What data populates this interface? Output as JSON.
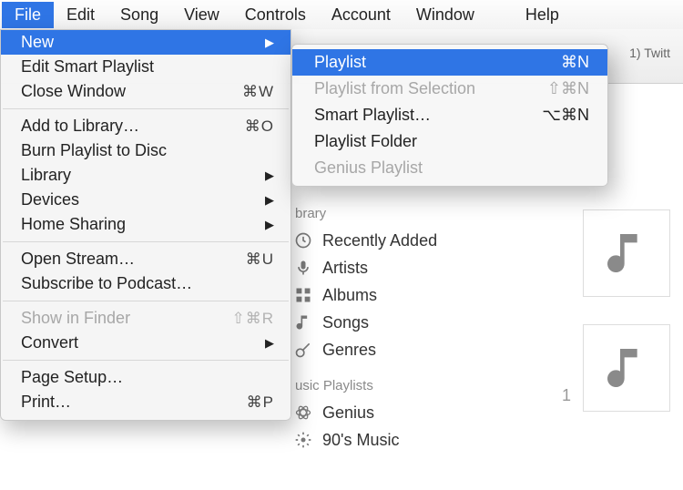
{
  "menubar": {
    "items": [
      "File",
      "Edit",
      "Song",
      "View",
      "Controls",
      "Account",
      "Window"
    ],
    "help": "Help",
    "active_index": 0
  },
  "tab_hint": "1) Twitt",
  "file_menu": {
    "rows": [
      {
        "label": "New",
        "type": "sub",
        "selected": true
      },
      {
        "label": "Edit Smart Playlist",
        "type": "item"
      },
      {
        "label": "Close Window",
        "type": "item",
        "shortcut": "⌘W"
      },
      {
        "type": "sep"
      },
      {
        "label": "Add to Library…",
        "type": "item",
        "shortcut": "⌘O"
      },
      {
        "label": "Burn Playlist to Disc",
        "type": "item"
      },
      {
        "label": "Library",
        "type": "sub"
      },
      {
        "label": "Devices",
        "type": "sub"
      },
      {
        "label": "Home Sharing",
        "type": "sub"
      },
      {
        "type": "sep"
      },
      {
        "label": "Open Stream…",
        "type": "item",
        "shortcut": "⌘U"
      },
      {
        "label": "Subscribe to Podcast…",
        "type": "item"
      },
      {
        "type": "sep"
      },
      {
        "label": "Show in Finder",
        "type": "item",
        "shortcut": "⇧⌘R",
        "disabled": true
      },
      {
        "label": "Convert",
        "type": "sub"
      },
      {
        "type": "sep"
      },
      {
        "label": "Page Setup…",
        "type": "item"
      },
      {
        "label": "Print…",
        "type": "item",
        "shortcut": "⌘P"
      }
    ]
  },
  "new_submenu": {
    "rows": [
      {
        "label": "Playlist",
        "shortcut": "⌘N",
        "selected": true
      },
      {
        "label": "Playlist from Selection",
        "shortcut": "⇧⌘N",
        "disabled": true
      },
      {
        "label": "Smart Playlist…",
        "shortcut": "⌥⌘N"
      },
      {
        "label": "Playlist Folder"
      },
      {
        "label": "Genius Playlist",
        "disabled": true
      }
    ]
  },
  "library": {
    "header1_partial": "brary",
    "items1": [
      "Recently Added",
      "Artists",
      "Albums",
      "Songs",
      "Genres"
    ],
    "header2_partial": "usic Playlists",
    "items2": [
      "Genius",
      "90's Music"
    ]
  },
  "cards": {
    "second_index": "1"
  }
}
